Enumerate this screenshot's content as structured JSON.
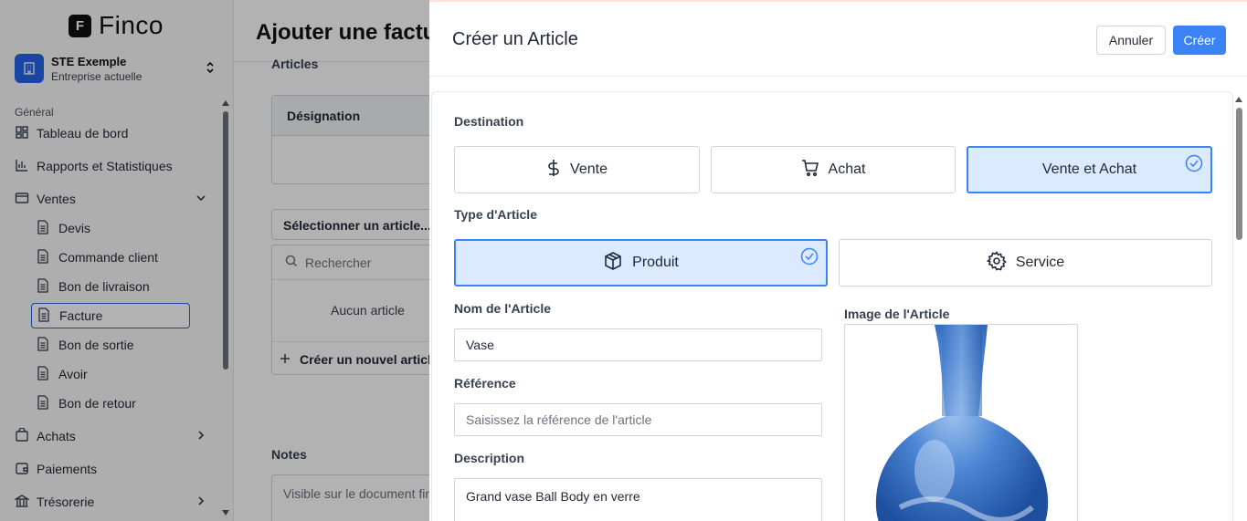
{
  "app": {
    "logo_letter": "F",
    "logo_text": "Finco",
    "company": {
      "name": "STE Exemple",
      "subtitle": "Entreprise actuelle"
    },
    "nav_group": "Général",
    "nav": {
      "dashboard": "Tableau de bord",
      "reports": "Rapports et Statistiques",
      "sales": "Ventes",
      "sales_items": [
        "Devis",
        "Commande client",
        "Bon de livraison",
        "Facture",
        "Bon de sortie",
        "Avoir",
        "Bon de retour"
      ],
      "purchases": "Achats",
      "payments": "Paiements",
      "treasury": "Trésorerie"
    }
  },
  "page": {
    "title": "Ajouter une factu",
    "articles_label": "Articles",
    "designation_header": "Désignation",
    "select_article": "Sélectionner un article...",
    "search_placeholder": "Rechercher",
    "no_article": "Aucun article",
    "create_new": "Créer un nouvel articl",
    "notes_label": "Notes",
    "notes_placeholder": "Visible sur le document fir"
  },
  "modal": {
    "title": "Créer un Article",
    "cancel": "Annuler",
    "create": "Créer",
    "destination_label": "Destination",
    "destination_options": [
      "Vente",
      "Achat",
      "Vente et Achat"
    ],
    "destination_selected": "Vente et Achat",
    "type_label": "Type d'Article",
    "type_options": [
      "Produit",
      "Service"
    ],
    "type_selected": "Produit",
    "name_label": "Nom de l'Article",
    "name_value": "Vase",
    "reference_label": "Référence",
    "reference_placeholder": "Saisissez la référence de l'article",
    "description_label": "Description",
    "description_value": "Grand vase Ball Body en verre",
    "image_label": "Image de l'Article"
  },
  "colors": {
    "accent": "#3b82f6",
    "selected_bg": "#dbeafe",
    "brand": "#2563eb"
  }
}
